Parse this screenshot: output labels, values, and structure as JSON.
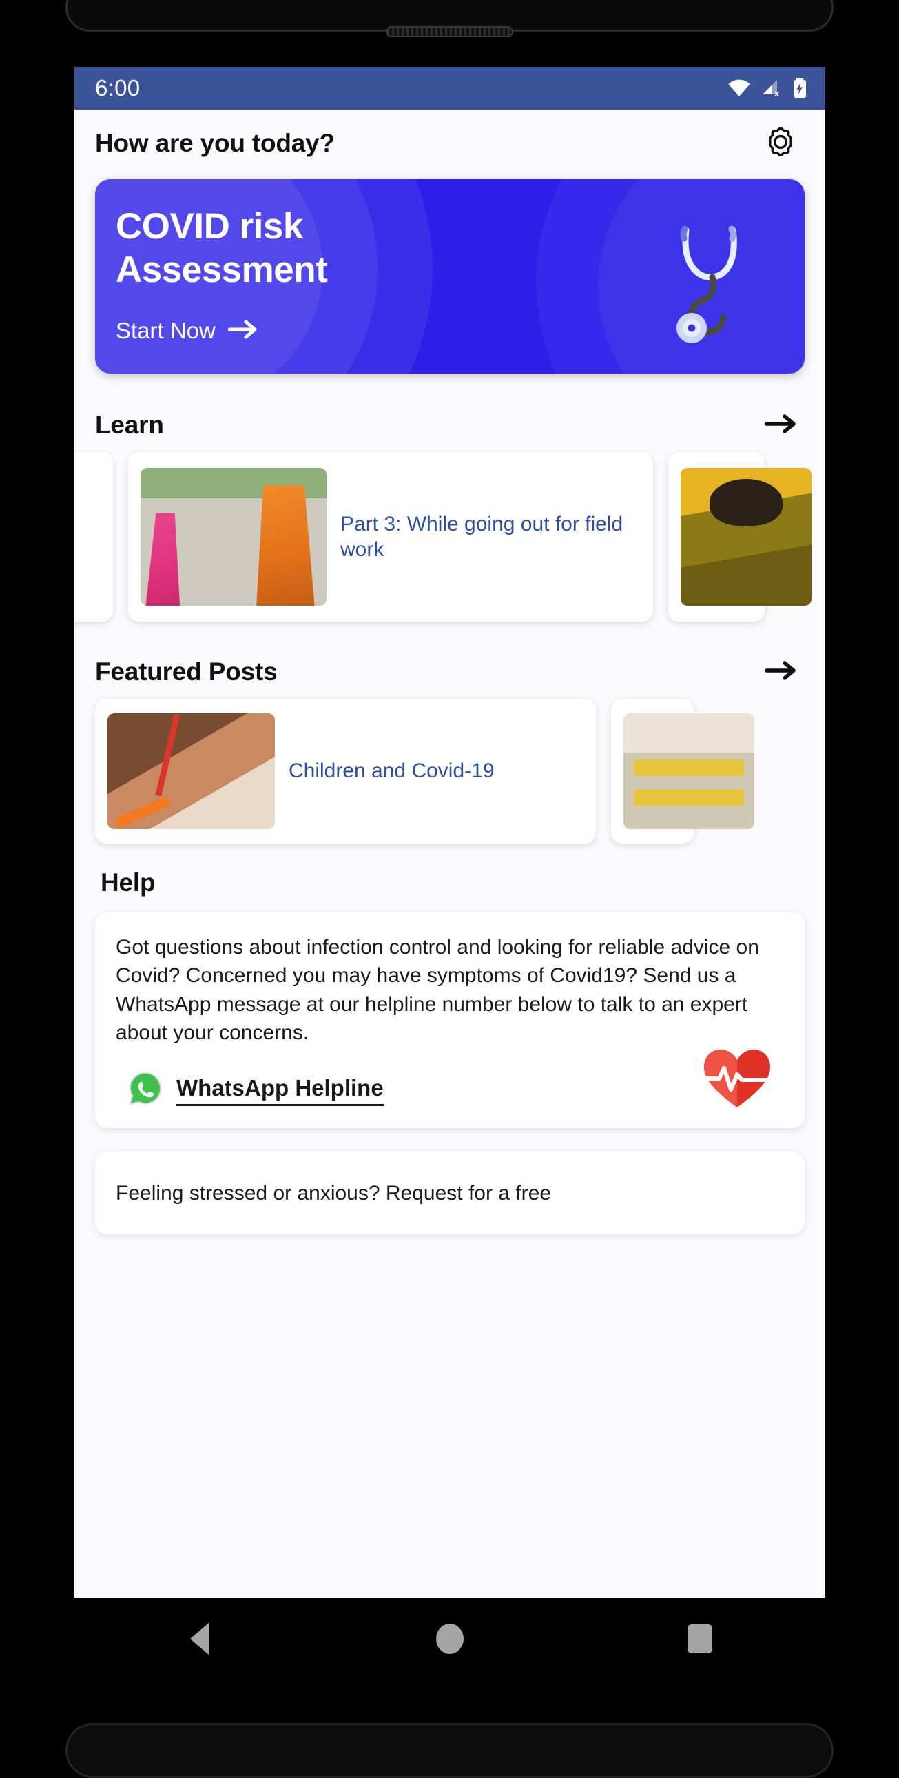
{
  "status_bar": {
    "time": "6:00",
    "icons": [
      "wifi-icon",
      "cellular-signal-off-icon",
      "battery-charging-icon"
    ],
    "background_color": "#3b5399"
  },
  "header": {
    "greeting": "How are you today?",
    "settings_icon": "gear-icon"
  },
  "covid_banner": {
    "title_line1": "COVID risk",
    "title_line2": "Assessment",
    "cta_label": "Start Now",
    "cta_icon": "arrow-right-icon",
    "illustration": "stethoscope-icon",
    "background_color": "#2b1fe8",
    "text_color": "#ffffff"
  },
  "learn": {
    "section_title": "Learn",
    "see_all_icon": "arrow-right-icon",
    "cards": [
      {
        "label": "",
        "thumb": "partial-card"
      },
      {
        "label": "Part 3: While going out for field work",
        "thumb": "health-workers-field-photo"
      },
      {
        "label": "",
        "thumb": "health-worker-yellow-photo"
      }
    ]
  },
  "featured": {
    "section_title": "Featured Posts",
    "see_all_icon": "arrow-right-icon",
    "cards": [
      {
        "label": "Children and Covid-19",
        "thumb": "child-writing-photo"
      },
      {
        "label": "",
        "thumb": "classroom-desks-photo"
      }
    ]
  },
  "help": {
    "section_title": "Help",
    "paragraph": "Got questions about infection control and looking for reliable advice on Covid? Concerned you may have symptoms of Covid19? Send us a WhatsApp message at our helpline number below to talk to an expert about your concerns.",
    "helpline_label": "WhatsApp Helpline",
    "helpline_icon": "whatsapp-icon",
    "accent_icon": "heart-pulse-icon",
    "accent_color": "#e03127",
    "whatsapp_color": "#25d366",
    "stress_paragraph": "Feeling stressed or anxious? Request for a free"
  },
  "nav_bar": {
    "back_label": "back-button",
    "home_label": "home-button",
    "recents_label": "recents-button"
  },
  "theme": {
    "link_color": "#2f4f9e",
    "page_background": "#fbfbfd"
  }
}
